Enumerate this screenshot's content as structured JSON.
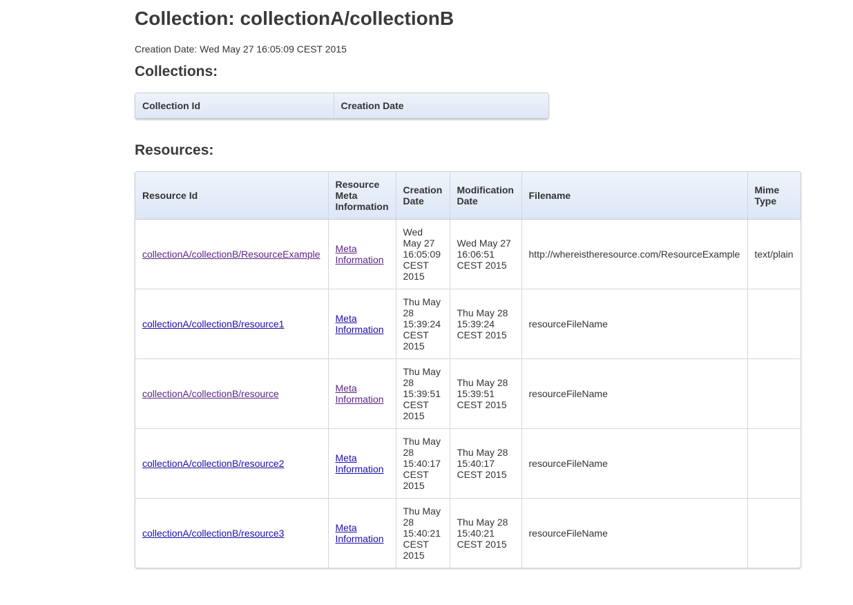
{
  "page": {
    "title": "Collection: collectionA/collectionB",
    "creation_date": "Creation Date: Wed May 27 16:05:09 CEST 2015"
  },
  "collections": {
    "heading": "Collections:",
    "columns": [
      "Collection Id",
      "Creation Date"
    ],
    "rows": []
  },
  "resources": {
    "heading": "Resources:",
    "columns": [
      "Resource Id",
      "Resource Meta Information",
      "Creation Date",
      "Modification Date",
      "Filename",
      "Mime Type"
    ],
    "rows": [
      {
        "id": "collectionA/collectionB/ResourceExample",
        "meta": "Meta Information",
        "created": "Wed May 27 16:05:09 CEST 2015",
        "modified": "Wed May 27 16:06:51 CEST 2015",
        "filename": "http://whereistheresource.com/ResourceExample",
        "mime": "text/plain",
        "visited": true
      },
      {
        "id": "collectionA/collectionB/resource1",
        "meta": "Meta Information",
        "created": "Thu May 28 15:39:24 CEST 2015",
        "modified": "Thu May 28 15:39:24 CEST 2015",
        "filename": "resourceFileName",
        "mime": "",
        "visited": false
      },
      {
        "id": "collectionA/collectionB/resource",
        "meta": "Meta Information",
        "created": "Thu May 28 15:39:51 CEST 2015",
        "modified": "Thu May 28 15:39:51 CEST 2015",
        "filename": "resourceFileName",
        "mime": "",
        "visited": true
      },
      {
        "id": "collectionA/collectionB/resource2",
        "meta": "Meta Information",
        "created": "Thu May 28 15:40:17 CEST 2015",
        "modified": "Thu May 28 15:40:17 CEST 2015",
        "filename": "resourceFileName",
        "mime": "",
        "visited": false
      },
      {
        "id": "collectionA/collectionB/resource3",
        "meta": "Meta Information",
        "created": "Thu May 28 15:40:21 CEST 2015",
        "modified": "Thu May 28 15:40:21 CEST 2015",
        "filename": "resourceFileName",
        "mime": "",
        "visited": false
      }
    ]
  }
}
